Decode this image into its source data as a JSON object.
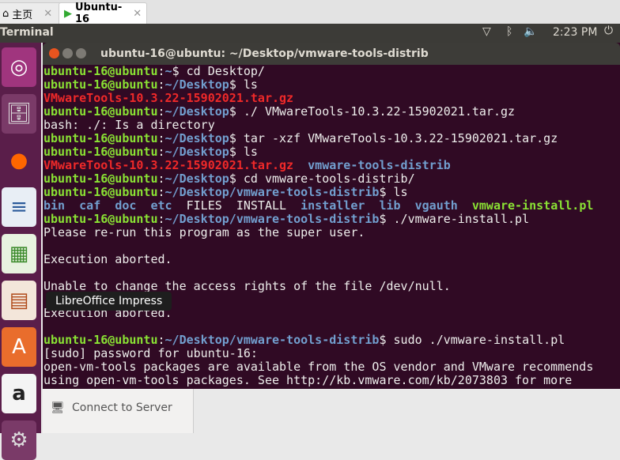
{
  "tabs": [
    {
      "label": "主页",
      "close": "✕"
    },
    {
      "label": "Ubuntu-16",
      "close": "✕"
    }
  ],
  "panel": {
    "app": "Terminal",
    "time": "2:23 PM"
  },
  "window": {
    "title": "ubuntu-16@ubuntu: ~/Desktop/vmware-tools-distrib"
  },
  "tooltip": "LibreOffice Impress",
  "sidebar_item": "Connect to Server",
  "terminal": {
    "user": "ubuntu-16@ubuntu",
    "lines": [
      {
        "p": ":~",
        "c": "$ cd Desktop/"
      },
      {
        "p": ":~/Desktop",
        "c": "$ ls"
      },
      {
        "red": "VMwareTools-10.3.22-15902021.tar.gz"
      },
      {
        "p": ":~/Desktop",
        "c": "$ ./ VMwareTools-10.3.22-15902021.tar.gz"
      },
      {
        "t": "bash: ./: Is a directory"
      },
      {
        "p": ":~/Desktop",
        "c": "$ tar -xzf VMwareTools-10.3.22-15902021.tar.gz"
      },
      {
        "p": ":~/Desktop",
        "c": "$ ls"
      },
      {
        "red": "VMwareTools-10.3.22-15902021.tar.gz",
        "blue": "vmware-tools-distrib"
      },
      {
        "p": ":~/Desktop",
        "c": "$ cd vmware-tools-distrib/"
      },
      {
        "p": ":~/Desktop/vmware-tools-distrib",
        "c": "$ ls"
      },
      {
        "ls": [
          {
            "n": "bin",
            "k": "b"
          },
          {
            "n": "caf",
            "k": "b"
          },
          {
            "n": "doc",
            "k": "b"
          },
          {
            "n": "etc",
            "k": "b"
          },
          {
            "n": "FILES",
            "k": ""
          },
          {
            "n": "INSTALL",
            "k": ""
          },
          {
            "n": "installer",
            "k": "b"
          },
          {
            "n": "lib",
            "k": "b"
          },
          {
            "n": "vgauth",
            "k": "b"
          },
          {
            "n": "vmware-install.pl",
            "k": "g"
          }
        ]
      },
      {
        "p": ":~/Desktop/vmware-tools-distrib",
        "c": "$ ./vmware-install.pl"
      },
      {
        "t": "Please re-run this program as the super user."
      },
      {
        "t": ""
      },
      {
        "t": "Execution aborted."
      },
      {
        "t": ""
      },
      {
        "t": "Unable to change the access rights of the file /dev/null."
      },
      {
        "t": ""
      },
      {
        "t": "Execution aborted."
      },
      {
        "t": ""
      },
      {
        "p": ":~/Desktop/vmware-tools-distrib",
        "c": "$ sudo ./vmware-install.pl"
      },
      {
        "t": "[sudo] password for ubuntu-16:"
      },
      {
        "t": "open-vm-tools packages are available from the OS vendor and VMware recommends"
      },
      {
        "t": "using open-vm-tools packages. See http://kb.vmware.com/kb/2073803 for more"
      }
    ]
  }
}
